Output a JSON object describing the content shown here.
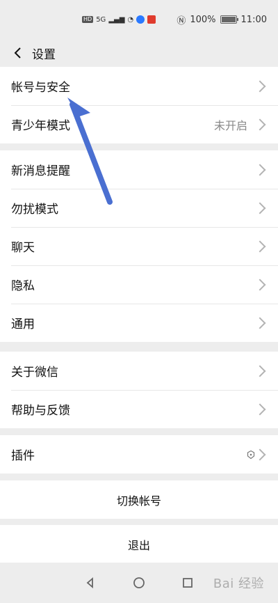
{
  "status_bar": {
    "left_items": [
      "HD",
      "5G",
      "ill",
      "wifi",
      "S",
      "F"
    ],
    "battery": "100%",
    "time": "11:00"
  },
  "header": {
    "title": "设置"
  },
  "groups": {
    "account": {
      "items": [
        {
          "label": "帐号与安全",
          "value": ""
        },
        {
          "label": "青少年模式",
          "value": "未开启"
        }
      ]
    },
    "settings": {
      "items": [
        {
          "label": "新消息提醒"
        },
        {
          "label": "勿扰模式"
        },
        {
          "label": "聊天"
        },
        {
          "label": "隐私"
        },
        {
          "label": "通用"
        }
      ]
    },
    "about": {
      "items": [
        {
          "label": "关于微信"
        },
        {
          "label": "帮助与反馈"
        }
      ]
    },
    "plugins": {
      "items": [
        {
          "label": "插件"
        }
      ]
    },
    "actions": {
      "switch_account": "切换帐号",
      "logout": "退出"
    }
  },
  "navigation": {
    "back_icon": "chevron-left-icon",
    "home_icon": "circle-icon",
    "recent_icon": "square-icon"
  },
  "watermark": {
    "text": "Bai 经验"
  }
}
